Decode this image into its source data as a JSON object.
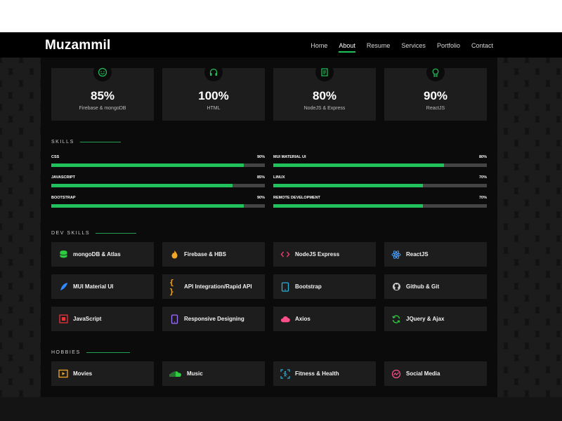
{
  "brand": {
    "name": "Muzammil",
    "accent": "#20c05a"
  },
  "nav": [
    {
      "label": "Home",
      "active": false
    },
    {
      "label": "About",
      "active": true
    },
    {
      "label": "Resume",
      "active": false
    },
    {
      "label": "Services",
      "active": false
    },
    {
      "label": "Portfolio",
      "active": false
    },
    {
      "label": "Contact",
      "active": false
    }
  ],
  "stats": [
    {
      "value": "85%",
      "label": "Firebase & mongoDB",
      "icon": "smile-icon"
    },
    {
      "value": "100%",
      "label": "HTML",
      "icon": "headphones-icon"
    },
    {
      "value": "80%",
      "label": "NodeJS & Express",
      "icon": "document-icon"
    },
    {
      "value": "90%",
      "label": "ReactJS",
      "icon": "badge-icon"
    }
  ],
  "skills_title": "SKILLS",
  "skills": [
    {
      "name": "CSS",
      "pct": "90%",
      "level": 0.9
    },
    {
      "name": "MUI MATERIAL UI",
      "pct": "80%",
      "level": 0.8
    },
    {
      "name": "JAVASCRIPT",
      "pct": "85%",
      "level": 0.85
    },
    {
      "name": "LINUX",
      "pct": "70%",
      "level": 0.7
    },
    {
      "name": "BOOTSTRAP",
      "pct": "90%",
      "level": 0.9
    },
    {
      "name": "REMOTE DEVELOPMENT",
      "pct": "70%",
      "level": 0.7
    }
  ],
  "dev_skills_title": "DEV SKILLS",
  "dev_skills": [
    {
      "label": "mongoDB & Atlas",
      "icon": "database-icon",
      "color": "#2ecc40"
    },
    {
      "label": "Firebase & HBS",
      "icon": "flame-icon",
      "color": "#f5a623"
    },
    {
      "label": "NodeJS Express",
      "icon": "code-icon",
      "color": "#e83e6c"
    },
    {
      "label": "ReactJS",
      "icon": "react-icon",
      "color": "#4aa3ff"
    },
    {
      "label": "MUI Material UI",
      "icon": "feather-icon",
      "color": "#2f8cff"
    },
    {
      "label": "API Integration/Rapid API",
      "icon": "braces-icon",
      "color": "#f5a623"
    },
    {
      "label": "Bootstrap",
      "icon": "tablet-icon",
      "color": "#2bb0d8"
    },
    {
      "label": "Github & Git",
      "icon": "github-icon",
      "color": "#cccccc"
    },
    {
      "label": "JavaScript",
      "icon": "js-icon",
      "color": "#e8333a"
    },
    {
      "label": "Responsive Designing",
      "icon": "phone-icon",
      "color": "#a070ff"
    },
    {
      "label": "Axios",
      "icon": "cloud-icon",
      "color": "#ff4f8b"
    },
    {
      "label": "JQuery & Ajax",
      "icon": "refresh-icon",
      "color": "#2ecc40"
    }
  ],
  "hobbies_title": "HOBBIES",
  "hobbies": [
    {
      "label": "Movies",
      "icon": "film-icon",
      "color": "#f5a623"
    },
    {
      "label": "Music",
      "icon": "soundcloud-icon",
      "color": "#2ecc40"
    },
    {
      "label": "Fitness & Health",
      "icon": "fitness-icon",
      "color": "#2bb0d8"
    },
    {
      "label": "Social Media",
      "icon": "social-icon",
      "color": "#ff4f8b"
    }
  ]
}
